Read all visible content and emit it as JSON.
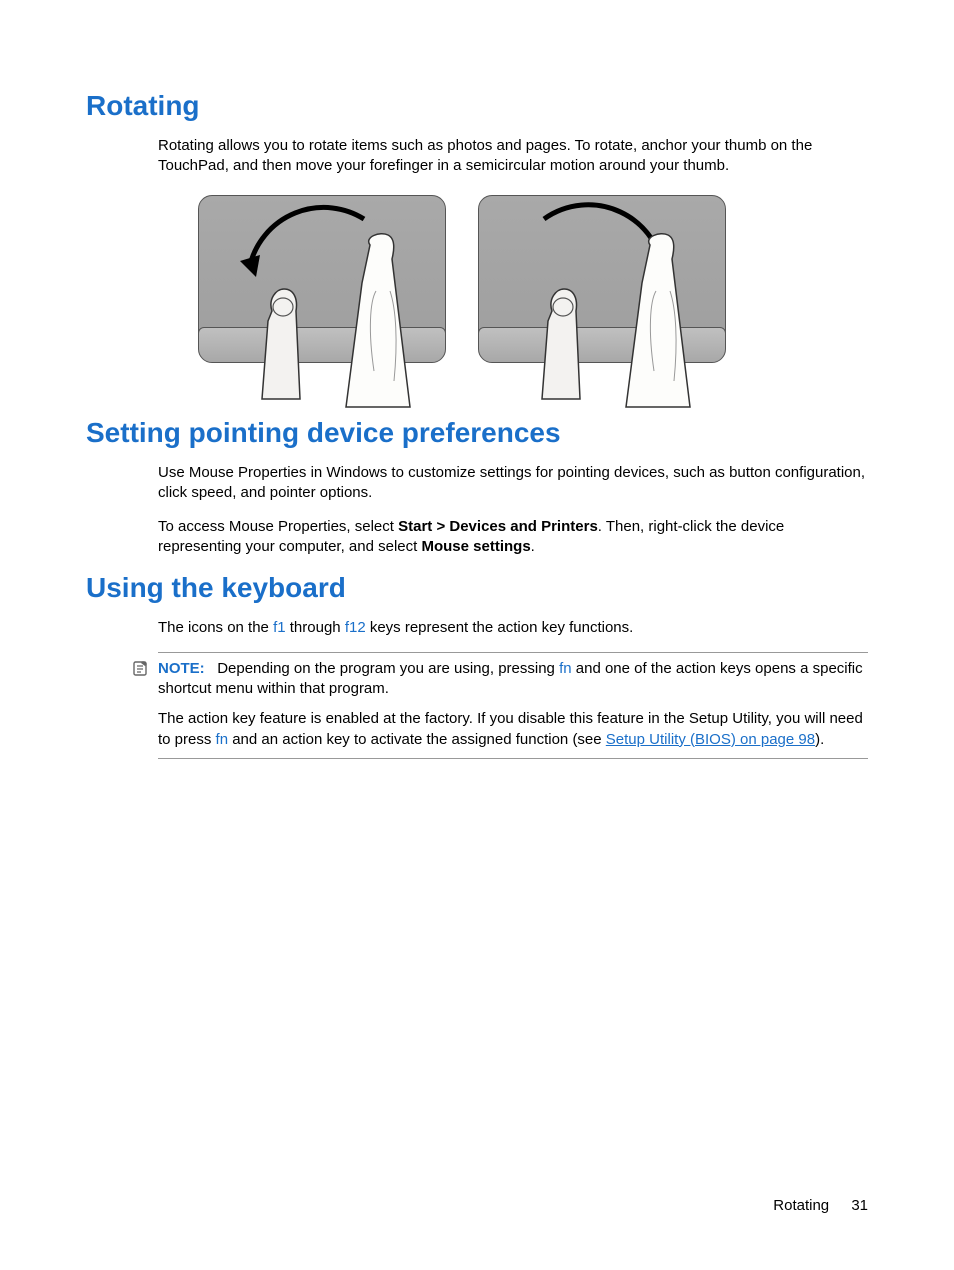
{
  "sections": {
    "rotating": {
      "title": "Rotating",
      "p1": "Rotating allows you to rotate items such as photos and pages. To rotate, anchor your thumb on the TouchPad, and then move your forefinger in a semicircular motion around your thumb."
    },
    "pointing": {
      "title": "Setting pointing device preferences",
      "p1": "Use Mouse Properties in Windows to customize settings for pointing devices, such as button configuration, click speed, and pointer options.",
      "p2_a": "To access Mouse Properties, select ",
      "p2_bold1": "Start > Devices and Printers",
      "p2_b": ". Then, right-click the device representing your computer, and select ",
      "p2_bold2": "Mouse settings",
      "p2_c": "."
    },
    "keyboard": {
      "title": "Using the keyboard",
      "intro_a": "The icons on the ",
      "intro_key1": "f1",
      "intro_b": " through ",
      "intro_key2": "f12",
      "intro_c": " keys represent the action key functions.",
      "note_label": "NOTE:",
      "note_a": "Depending on the program you are using, pressing ",
      "note_key": "fn",
      "note_b": " and one of the action keys opens a specific shortcut menu within that program.",
      "p2_a": "The action key feature is enabled at the factory. If you disable this feature in the Setup Utility, you will need to press ",
      "p2_key": "fn",
      "p2_b": " and an action key to activate the assigned function (see ",
      "p2_link": "Setup Utility (BIOS) on page 98",
      "p2_c": ")."
    }
  },
  "footer": {
    "section": "Rotating",
    "page": "31"
  }
}
